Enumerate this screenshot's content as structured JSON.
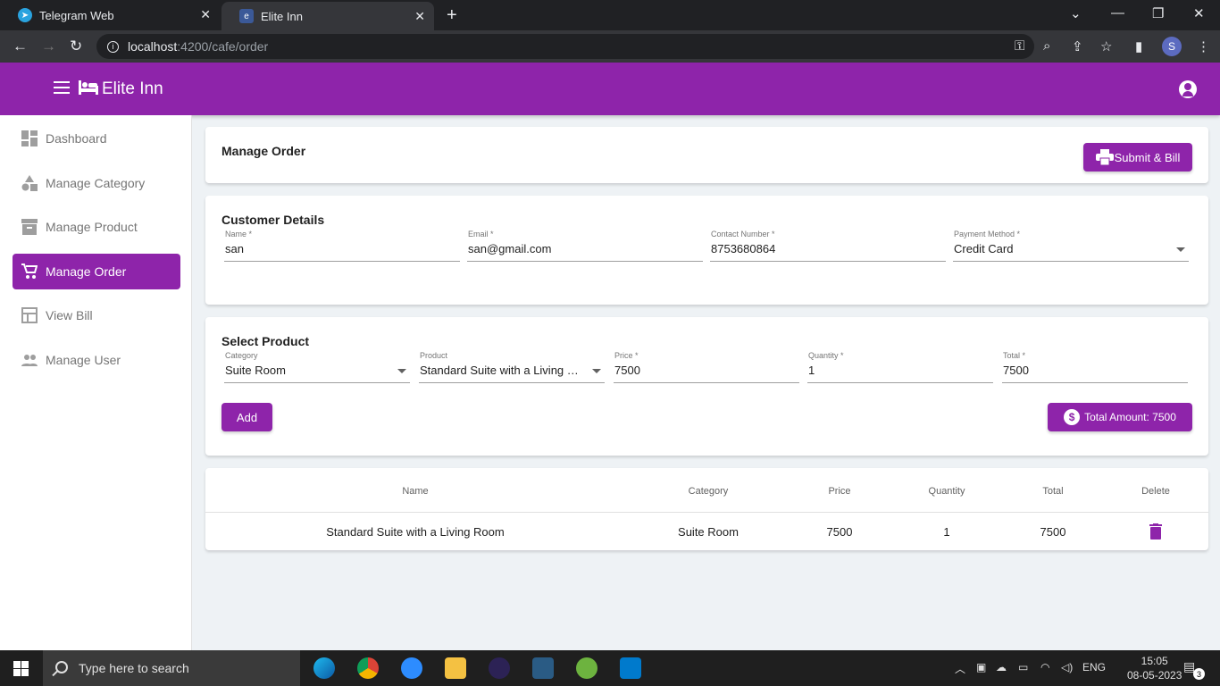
{
  "browser": {
    "tabs": [
      {
        "title": "Telegram Web"
      },
      {
        "title": "Elite Inn"
      }
    ],
    "url_host": "localhost",
    "url_path": ":4200/cafe/order",
    "profile_initial": "S"
  },
  "header": {
    "brand": "Elite Inn"
  },
  "sidebar": {
    "items": [
      {
        "label": "Dashboard"
      },
      {
        "label": "Manage Category"
      },
      {
        "label": "Manage Product"
      },
      {
        "label": "Manage Order"
      },
      {
        "label": "View Bill"
      },
      {
        "label": "Manage User"
      }
    ]
  },
  "manage_order": {
    "title": "Manage Order",
    "submit_label": "Submit & Bill"
  },
  "customer": {
    "title": "Customer Details",
    "name_label": "Name *",
    "name_value": "san",
    "email_label": "Email *",
    "email_value": "san@gmail.com",
    "contact_label": "Contact Number *",
    "contact_value": "8753680864",
    "payment_label": "Payment Method *",
    "payment_value": "Credit Card"
  },
  "product": {
    "title": "Select Product",
    "category_label": "Category",
    "category_value": "Suite Room",
    "product_label": "Product",
    "product_value": "Standard Suite with a Living Room",
    "price_label": "Price *",
    "price_value": "7500",
    "quantity_label": "Quantity *",
    "quantity_value": "1",
    "total_label": "Total *",
    "total_value": "7500",
    "add_label": "Add",
    "total_amount_label": "Total Amount: 7500"
  },
  "table": {
    "headers": [
      "Name",
      "Category",
      "Price",
      "Quantity",
      "Total",
      "Delete"
    ],
    "rows": [
      {
        "name": "Standard Suite with a Living Room",
        "category": "Suite Room",
        "price": "7500",
        "quantity": "1",
        "total": "7500"
      }
    ]
  },
  "taskbar": {
    "search_placeholder": "Type here to search",
    "language": "ENG",
    "time": "15:05",
    "date": "08-05-2023",
    "notification_count": "3"
  },
  "colors": {
    "primary": "#8e24aa"
  }
}
